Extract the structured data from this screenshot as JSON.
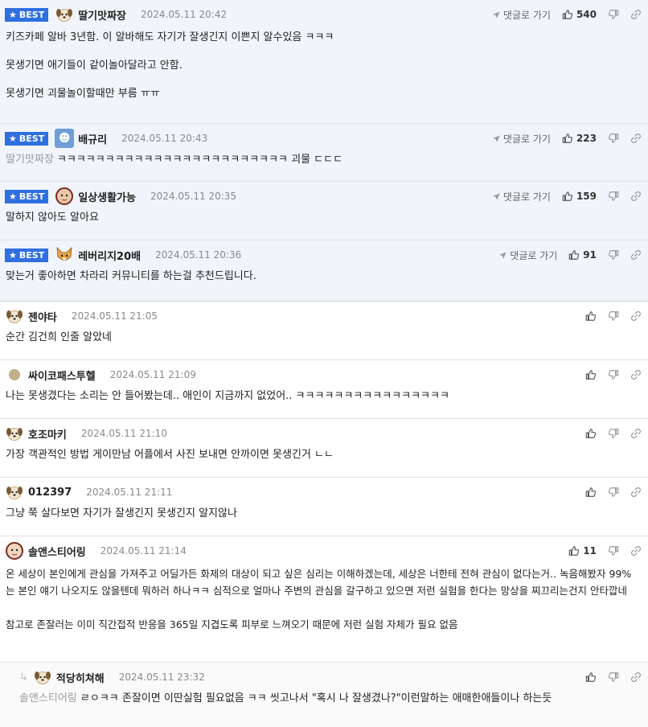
{
  "labels": {
    "best": "BEST",
    "goto_reply": "댓글로 가기"
  },
  "icons": {
    "star": "star-icon",
    "like": "thumbs-up-icon",
    "dislike": "thumbs-down-icon",
    "link": "link-icon",
    "arrow": "arrow-icon"
  },
  "colors": {
    "best_badge": "#2f6fe0",
    "best_bg": "#f1f4fa"
  },
  "comments": [
    {
      "nick": "딸기맛짜장",
      "date": "2024.05.11 20:42",
      "likes": "540",
      "text": "키즈카페 알바 3년함. 이 알바해도 자기가 잘생긴지 이쁜지 알수있음 ㅋㅋㅋ\n\n못생기면 애기들이 같이놀아달라고 안함.\n\n못생기면 괴물놀이할때만 부름 ㅠㅠ"
    },
    {
      "nick": "배규리",
      "date": "2024.05.11 20:43",
      "likes": "223",
      "mention": "딸기맛짜장",
      "text": "ㅋㅋㅋㅋㅋㅋㅋㅋㅋㅋㅋㅋㅋㅋㅋㅋㅋㅋㅋㅋㅋㅋㅋㅋ 괴물 ㄷㄷㄷ"
    },
    {
      "nick": "일상생활가능",
      "date": "2024.05.11 20:35",
      "likes": "159",
      "text": "말하지 않아도 알아요"
    },
    {
      "nick": "레버리지20배",
      "date": "2024.05.11 20:36",
      "likes": "91",
      "text": "맞는거 좋아하면 차라리 커뮤니티를 하는걸 추천드립니다."
    },
    {
      "nick": "젠야타",
      "date": "2024.05.11 21:05",
      "text": "순간 김건희 인줄 알았네"
    },
    {
      "nick": "싸이코패스투헬",
      "date": "2024.05.11 21:09",
      "text": "나는 못생겼다는 소리는 안 들어봤는데.. 애인이 지금까지 없었어.. ㅋㅋㅋㅋㅋㅋㅋㅋㅋㅋㅋㅋㅋㅋㅋㅋ"
    },
    {
      "nick": "호조마키",
      "date": "2024.05.11 21:10",
      "text": "가장 객관적인 방법 게이만남 어플에서 사진 보내면 안까이면 못생긴거 ㄴㄴ"
    },
    {
      "nick": "012397",
      "date": "2024.05.11 21:11",
      "text": "그냥 쭉 살다보면 자기가 잘생긴지 못생긴지 알지않나"
    },
    {
      "nick": "솔앤스티어링",
      "date": "2024.05.11 21:14",
      "likes": "11",
      "text": "온 세상이 본인에게 관심을 가져주고 어딜가든 화제의 대상이 되고 싶은 심리는 이해하겠는데, 세상은 너한테 전혀 관심이 없다는거.. 녹음해봤자 99%는 본인 얘기 나오지도 않을텐데 뭐하러 하나ㅋㅋ 심적으로 얼마나 주변의 관심을 갈구하고 있으면 저런 실험을 한다는 망상을 찌끄리는건지 안타깝네\n\n참고로 존잘러는 이미 직간접적 반응을 365일 지겹도록 피부로 느껴오기 때문에 저런 실험 자체가 필요 없음"
    },
    {
      "nick": "적당히쳐해",
      "date": "2024.05.11 23:32",
      "mention": "솔앤스티어링",
      "text": "ㄹㅇㅋㅋ 존잘이면 이딴실험 필요없음 ㅋㅋ 씻고나서 \"혹시 나 잘생겼나?\"이런말하는 애매한애들이나 하는듯"
    }
  ]
}
